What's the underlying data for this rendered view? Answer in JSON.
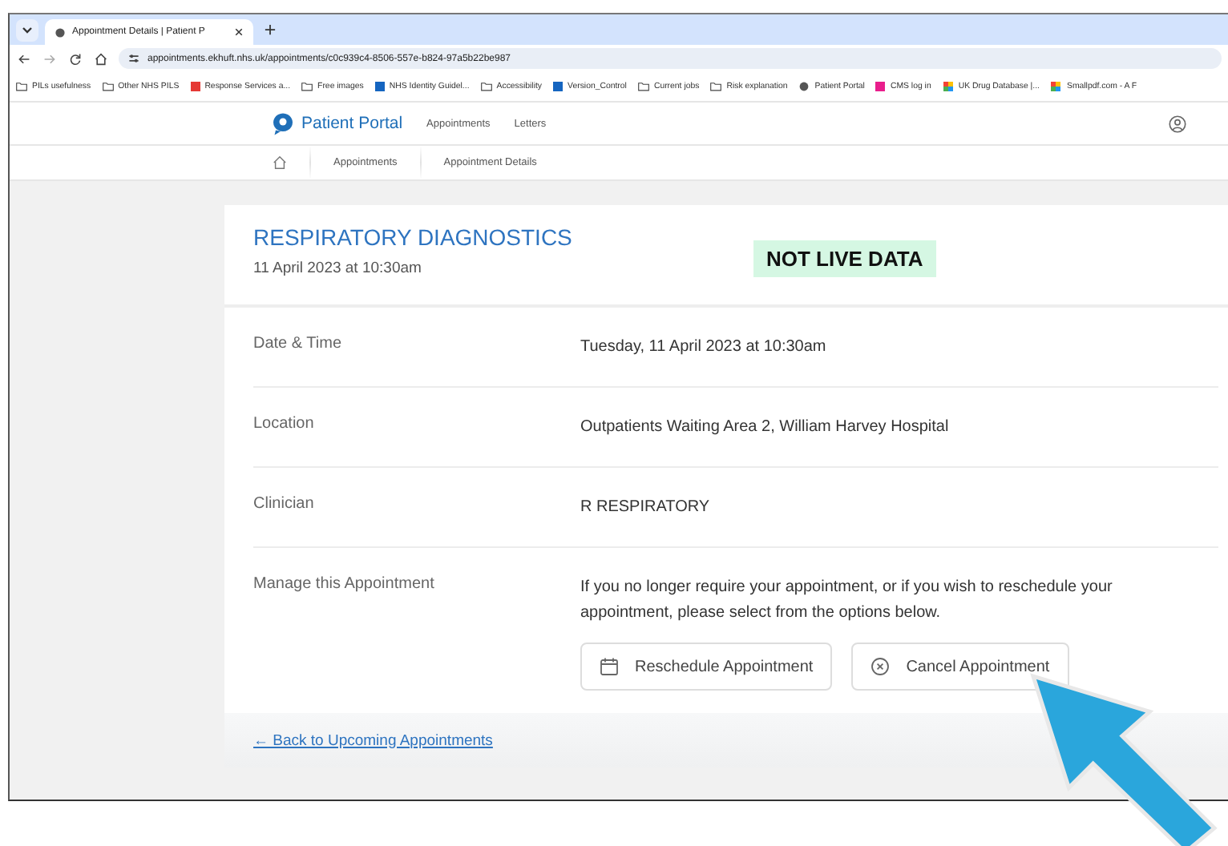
{
  "browser": {
    "tab_title": "Appointment Details | Patient P",
    "url": "appointments.ekhuft.nhs.uk/appointments/c0c939c4-8506-557e-b824-97a5b22be987",
    "bookmarks": [
      {
        "label": "PILs usefulness",
        "kind": "folder"
      },
      {
        "label": "Other NHS PILS",
        "kind": "folder"
      },
      {
        "label": "Response Services a...",
        "kind": "red"
      },
      {
        "label": "Free images",
        "kind": "folder"
      },
      {
        "label": "NHS Identity Guidel...",
        "kind": "blue"
      },
      {
        "label": "Accessibility",
        "kind": "folder"
      },
      {
        "label": "Version_Control",
        "kind": "blue"
      },
      {
        "label": "Current jobs",
        "kind": "folder"
      },
      {
        "label": "Risk explanation",
        "kind": "folder"
      },
      {
        "label": "Patient Portal",
        "kind": "globe"
      },
      {
        "label": "CMS log in",
        "kind": "pink"
      },
      {
        "label": "UK Drug Database |...",
        "kind": "grid"
      },
      {
        "label": "Smallpdf.com - A F",
        "kind": "grid"
      }
    ]
  },
  "portal": {
    "logo": "Patient Portal",
    "nav": [
      "Appointments",
      "Letters"
    ],
    "breadcrumb": [
      "Appointments",
      "Appointment Details"
    ]
  },
  "appointment": {
    "title": "RESPIRATORY DIAGNOSTICS",
    "date": "11 April 2023 at 10:30am",
    "notice": "NOT LIVE DATA",
    "rows": [
      {
        "label": "Date & Time",
        "value": "Tuesday, 11 April 2023 at 10:30am"
      },
      {
        "label": "Location",
        "value": "Outpatients Waiting Area 2, William Harvey Hospital"
      },
      {
        "label": "Clinician",
        "value": "R RESPIRATORY"
      },
      {
        "label": "Manage this Appointment",
        "value": "If you no longer require your appointment, or if you wish to reschedule your appointment, please select from the options below."
      }
    ],
    "buttons": [
      {
        "label": "Reschedule Appointment",
        "kind": "calendar"
      },
      {
        "label": "Cancel Appointment",
        "kind": "cancel"
      }
    ],
    "back_link": "← Back to Upcoming Appointments"
  }
}
